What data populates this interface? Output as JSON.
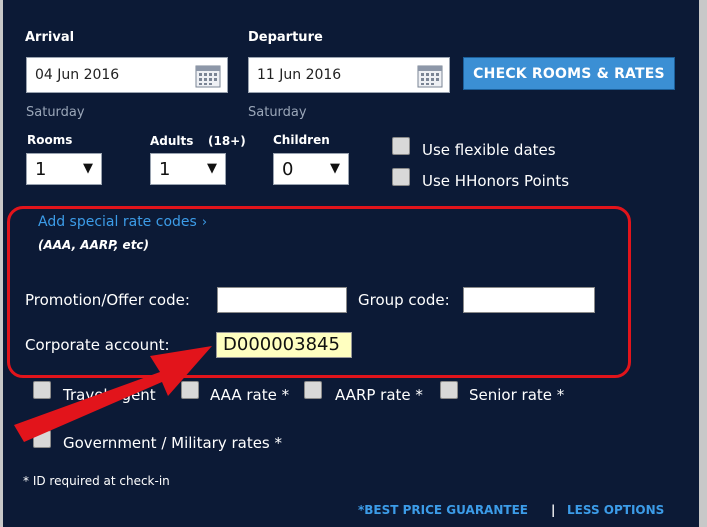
{
  "arrival": {
    "label": "Arrival",
    "date": "04 Jun 2016",
    "day": "Saturday"
  },
  "departure": {
    "label": "Departure",
    "date": "11 Jun 2016",
    "day": "Saturday"
  },
  "check_button": "CHECK ROOMS & RATES",
  "rooms": {
    "label": "Rooms",
    "value": "1"
  },
  "adults": {
    "label": "Adults",
    "note": "(18+)",
    "value": "1"
  },
  "children": {
    "label": "Children",
    "value": "0"
  },
  "options": {
    "flexible": "Use flexible dates",
    "hhonors": "Use HHonors Points"
  },
  "special": {
    "link": "Add special rate codes",
    "examples": "(AAA, AARP, etc)",
    "promo_label": "Promotion/Offer code:",
    "group_label": "Group code:",
    "corporate_label": "Corporate account:",
    "corporate_value": "D000003845"
  },
  "rates": {
    "travel_agent": "Travel agent",
    "aaa": "AAA rate *",
    "aarp": "AARP rate *",
    "senior": "Senior rate *",
    "government": "Government / Military rates *"
  },
  "id_note": "* ID required at check-in",
  "footer": {
    "best_price": "*BEST PRICE GUARANTEE",
    "separator": "|",
    "less_options": "LESS OPTIONS"
  },
  "colors": {
    "panel": "#0c1a36",
    "accent": "#3b8fd4",
    "link": "#3c9ce8",
    "highlight_box": "#e2141b",
    "arrow": "#e2141b"
  }
}
